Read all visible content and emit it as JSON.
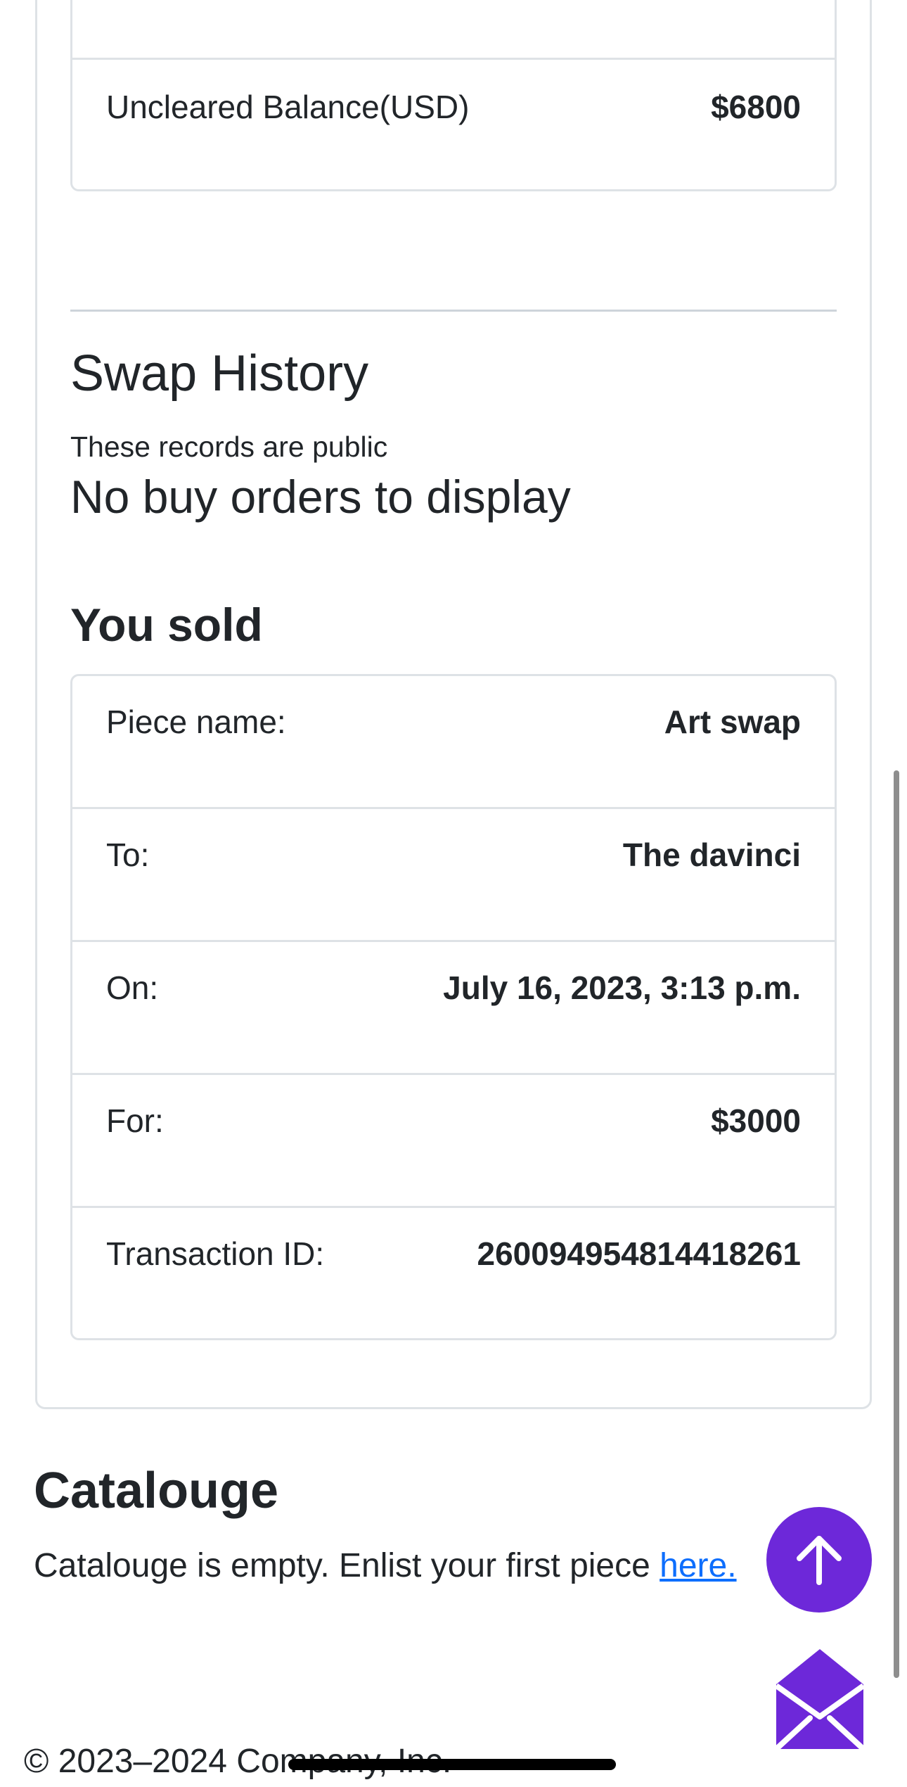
{
  "balance": {
    "uncleared_label": "Uncleared Balance(USD)",
    "uncleared_value": "$6800"
  },
  "swap_history": {
    "title": "Swap History",
    "subtitle": "These records are public",
    "no_buy_orders": "No buy orders to display",
    "sold_title": "You sold",
    "sold": [
      {
        "label": "Piece name:",
        "value": "Art swap"
      },
      {
        "label": "To:",
        "value": "The davinci"
      },
      {
        "label": "On:",
        "value": "July 16, 2023, 3:13 p.m."
      },
      {
        "label": "For:",
        "value": "$3000"
      },
      {
        "label": "Transaction ID:",
        "value": "2600949548144182​61"
      }
    ]
  },
  "catalogue": {
    "title": "Catalouge",
    "empty_text": "Catalouge is empty. Enlist your first piece ",
    "link_text": "here."
  },
  "footer": {
    "copyright": "© 2023–2024 Company, Inc."
  },
  "icons": {
    "scroll_top": "arrow-up-icon",
    "mail": "envelope-open-icon"
  },
  "colors": {
    "accent": "#6d28d9",
    "link": "#0d6efd",
    "border": "#dee2e6"
  }
}
